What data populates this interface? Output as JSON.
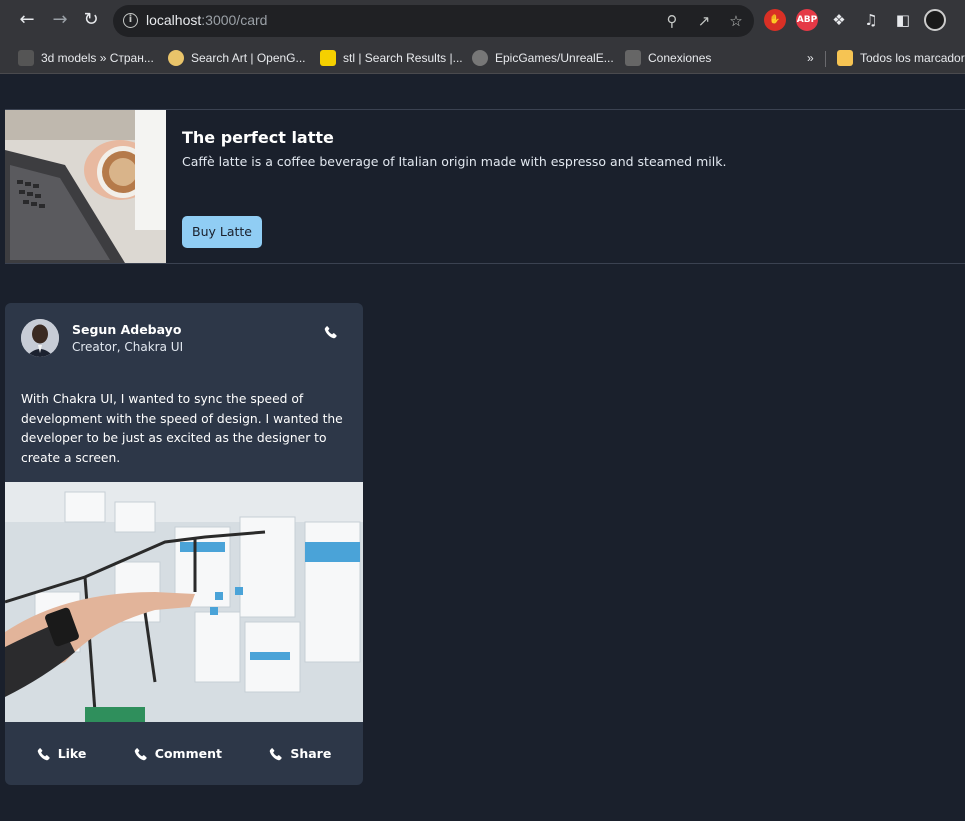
{
  "browser": {
    "url_host": "localhost",
    "url_path": ":3000/card",
    "extensions": [
      {
        "name": "hand-extension-icon",
        "label": "",
        "color": "#d93025"
      },
      {
        "name": "adblock-plus-icon",
        "label": "ABP",
        "color": "#e53946"
      }
    ]
  },
  "bookmarks": [
    {
      "label": "3d models » Стран..."
    },
    {
      "label": "Search Art | OpenG..."
    },
    {
      "label": "stl | Search Results |..."
    },
    {
      "label": "EpicGames/UnrealE..."
    },
    {
      "label": "Conexiones"
    }
  ],
  "bookmarks_overflow": "»",
  "bookmarks_folder": "Todos los marcadores",
  "latte_card": {
    "title": "The perfect latte",
    "description": "Caffè latte is a coffee beverage of Italian origin made with espresso and steamed milk.",
    "button_label": "Buy Latte"
  },
  "social_card": {
    "author_name": "Segun Adebayo",
    "author_role": "Creator, Chakra UI",
    "body": "With Chakra UI, I wanted to sync the speed of development with the speed of design. I wanted the developer to be just as excited as the designer to create a screen.",
    "actions": {
      "like": "Like",
      "comment": "Comment",
      "share": "Share"
    }
  },
  "colors": {
    "page_bg": "#1a202c",
    "card_bg": "#2d3748",
    "button_bg": "#90cdf4"
  }
}
